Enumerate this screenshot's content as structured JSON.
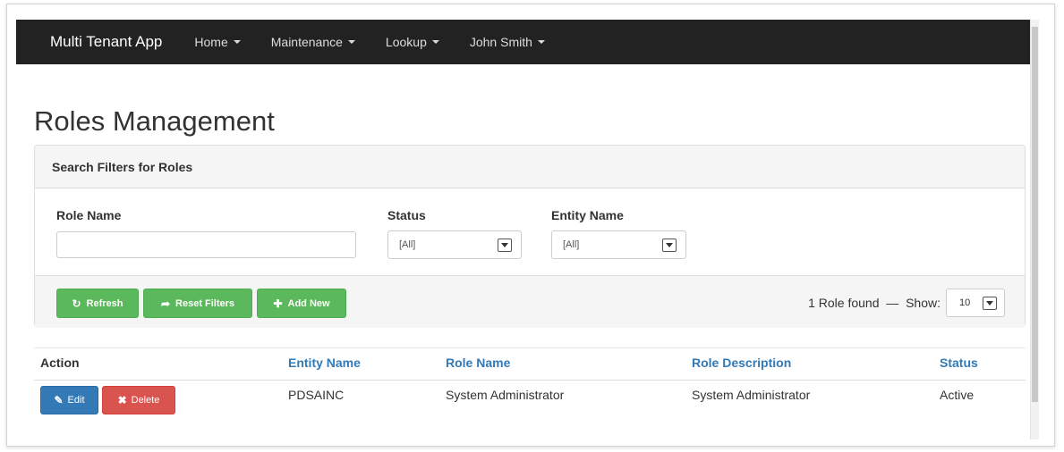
{
  "navbar": {
    "brand": "Multi Tenant App",
    "items": [
      {
        "label": "Home"
      },
      {
        "label": "Maintenance"
      },
      {
        "label": "Lookup"
      },
      {
        "label": "John Smith"
      }
    ]
  },
  "page": {
    "title": "Roles Management"
  },
  "filters": {
    "heading": "Search Filters for Roles",
    "role_name": {
      "label": "Role Name",
      "value": "",
      "placeholder": ""
    },
    "status": {
      "label": "Status",
      "selected": "[All]"
    },
    "entity_name": {
      "label": "Entity Name",
      "selected": "[All]"
    }
  },
  "actions": {
    "refresh_label": "Refresh",
    "reset_label": "Reset Filters",
    "add_label": "Add New",
    "found_text": "1 Role found",
    "separator": "—",
    "show_label": "Show:",
    "show_selected": "10"
  },
  "table": {
    "headers": {
      "action": "Action",
      "entity_name": "Entity Name",
      "role_name": "Role Name",
      "role_description": "Role Description",
      "status": "Status"
    },
    "rows": [
      {
        "edit_label": "Edit",
        "delete_label": "Delete",
        "entity_name": "PDSAINC",
        "role_name": "System Administrator",
        "role_description": "System Administrator",
        "status": "Active"
      }
    ]
  },
  "colors": {
    "navbar": "#222222",
    "success": "#5cb85c",
    "primary": "#337ab7",
    "danger": "#d9534f",
    "link": "#337ab7"
  },
  "icons": {
    "refresh": "refresh-icon",
    "reset": "share-arrow-icon",
    "add": "plus-icon",
    "edit": "edit-icon",
    "delete": "times-icon"
  }
}
